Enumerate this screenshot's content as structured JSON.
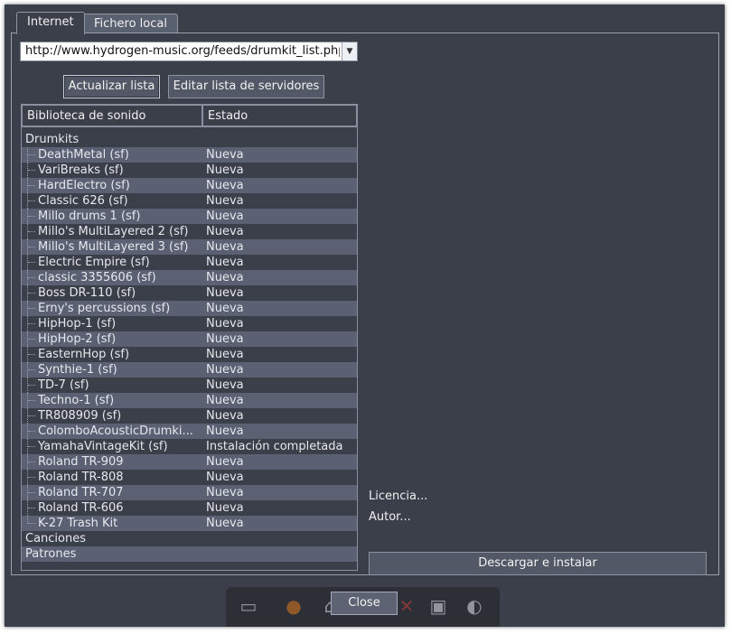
{
  "tabs": [
    {
      "label": "Internet"
    },
    {
      "label": "Fichero local"
    }
  ],
  "url": {
    "value": "http://www.hydrogen-music.org/feeds/drumkit_list.php"
  },
  "buttons": {
    "update": "Actualizar lista",
    "edit_servers": "Editar lista de servidores",
    "download": "Descargar e instalar",
    "close": "Close"
  },
  "table": {
    "headers": [
      "Biblioteca de sonido",
      "Estado"
    ],
    "categories": {
      "drumkits": "Drumkits",
      "songs": "Canciones",
      "patterns": "Patrones"
    },
    "rows": [
      {
        "name": "DeathMetal (sf)",
        "status": "Nueva"
      },
      {
        "name": "VariBreaks (sf)",
        "status": "Nueva"
      },
      {
        "name": "HardElectro (sf)",
        "status": "Nueva"
      },
      {
        "name": "Classic 626 (sf)",
        "status": "Nueva"
      },
      {
        "name": "Millo drums 1 (sf)",
        "status": "Nueva"
      },
      {
        "name": "Millo's MultiLayered 2 (sf)",
        "status": "Nueva"
      },
      {
        "name": "Millo's MultiLayered 3 (sf)",
        "status": "Nueva"
      },
      {
        "name": "Electric Empire (sf)",
        "status": "Nueva"
      },
      {
        "name": "classic 3355606 (sf)",
        "status": "Nueva"
      },
      {
        "name": "Boss DR-110 (sf)",
        "status": "Nueva"
      },
      {
        "name": "Erny's percussions (sf)",
        "status": "Nueva"
      },
      {
        "name": "HipHop-1 (sf)",
        "status": "Nueva"
      },
      {
        "name": "HipHop-2 (sf)",
        "status": "Nueva"
      },
      {
        "name": "EasternHop (sf)",
        "status": "Nueva"
      },
      {
        "name": "Synthie-1 (sf)",
        "status": "Nueva"
      },
      {
        "name": "TD-7 (sf)",
        "status": "Nueva"
      },
      {
        "name": "Techno-1 (sf)",
        "status": "Nueva"
      },
      {
        "name": "TR808909 (sf)",
        "status": "Nueva"
      },
      {
        "name": "ColomboAcousticDrumki...",
        "status": "Nueva"
      },
      {
        "name": "YamahaVintageKit (sf)",
        "status": "Instalación completada"
      },
      {
        "name": "Roland TR-909",
        "status": "Nueva"
      },
      {
        "name": "Roland TR-808",
        "status": "Nueva"
      },
      {
        "name": "Roland TR-707",
        "status": "Nueva"
      },
      {
        "name": "Roland TR-606",
        "status": "Nueva"
      },
      {
        "name": "K-27 Trash Kit",
        "status": "Nueva"
      }
    ]
  },
  "info": {
    "license": "Licencia...",
    "author": "Autor..."
  },
  "dock_icons": [
    "network-icon",
    "firefox-icon",
    "home-icon",
    "tools-icon",
    "hydrogen-icon",
    "speaker-icon"
  ]
}
